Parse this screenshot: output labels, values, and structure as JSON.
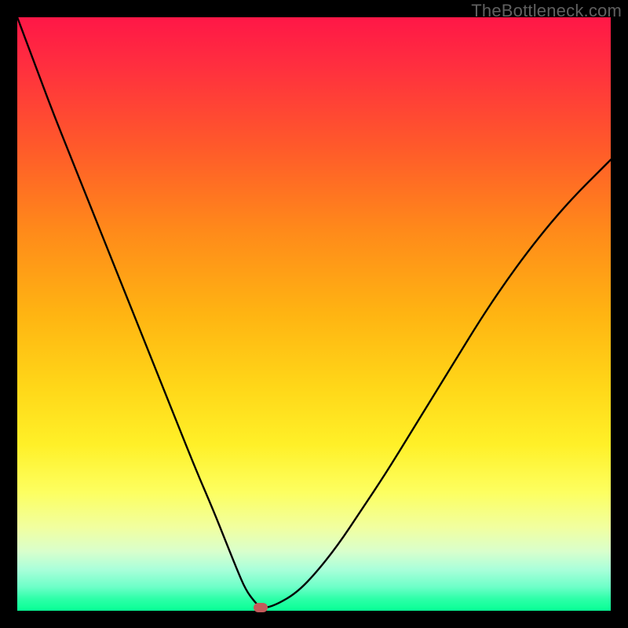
{
  "watermark": "TheBottleneck.com",
  "chart_data": {
    "type": "line",
    "title": "",
    "xlabel": "",
    "ylabel": "",
    "xlim": [
      0,
      100
    ],
    "ylim": [
      0,
      100
    ],
    "grid": false,
    "series": [
      {
        "name": "curve",
        "x": [
          0,
          3,
          6,
          9,
          12,
          15,
          18,
          21,
          24,
          27,
          30,
          33,
          35,
          37,
          38.5,
          40,
          41,
          42,
          44,
          47,
          50,
          54,
          58,
          62,
          66,
          70,
          74,
          78,
          82,
          86,
          90,
          94,
          98,
          100
        ],
        "values": [
          100,
          92,
          84,
          76.5,
          69,
          61.5,
          54,
          46.5,
          39,
          31.5,
          24,
          17,
          12,
          7,
          3.5,
          1.5,
          0.5,
          0.5,
          1.2,
          3,
          6,
          11,
          17,
          23,
          29.5,
          36,
          42.5,
          49,
          55,
          60.5,
          65.5,
          70,
          74,
          76
        ]
      }
    ],
    "min_point": {
      "x": 41,
      "y": 0
    },
    "marker_color": "#c45a5a",
    "line_color": "#000000",
    "line_width": 2.4,
    "background_gradient": {
      "top": "#ff1747",
      "bottom": "#07ff95"
    }
  }
}
